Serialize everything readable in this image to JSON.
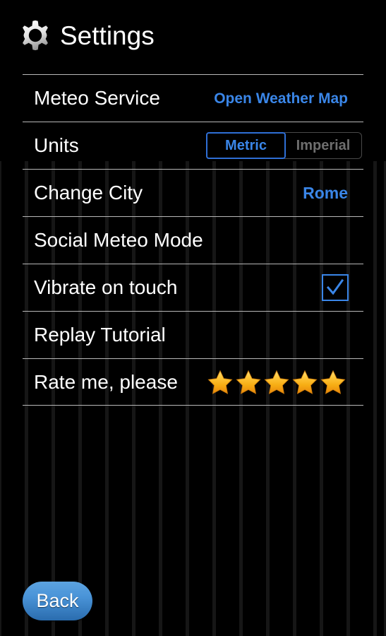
{
  "header": {
    "title": "Settings",
    "icon": "gear-icon"
  },
  "settings": {
    "rows": [
      {
        "label": "Meteo Service",
        "value": "Open Weather Map",
        "control": "value"
      },
      {
        "label": "Units",
        "control": "segmented"
      },
      {
        "label": "Change City",
        "value": "Rome",
        "control": "value"
      },
      {
        "label": "Social Meteo Mode",
        "control": "none"
      },
      {
        "label": "Vibrate on touch",
        "control": "checkbox"
      },
      {
        "label": "Replay Tutorial",
        "control": "none"
      },
      {
        "label": "Rate me, please",
        "control": "stars"
      }
    ]
  },
  "units_toggle": {
    "metric_label": "Metric",
    "imperial_label": "Imperial",
    "selected": "Metric"
  },
  "vibrate": {
    "checked": true,
    "check_glyph": "check-icon"
  },
  "rating": {
    "count": 5,
    "filled": 5
  },
  "footer": {
    "back_label": "Back"
  },
  "colors": {
    "accent_blue": "#3a86e8",
    "toggle_border_blue": "#2f6fd6",
    "inactive_gray": "#6e6e6e",
    "separator": "#b8b8b8",
    "star_light": "#ffd24d",
    "star_dark": "#f0960a",
    "background": "#000000",
    "button_blue_top": "#5ca3e0",
    "button_blue_bottom": "#2a6cae"
  }
}
